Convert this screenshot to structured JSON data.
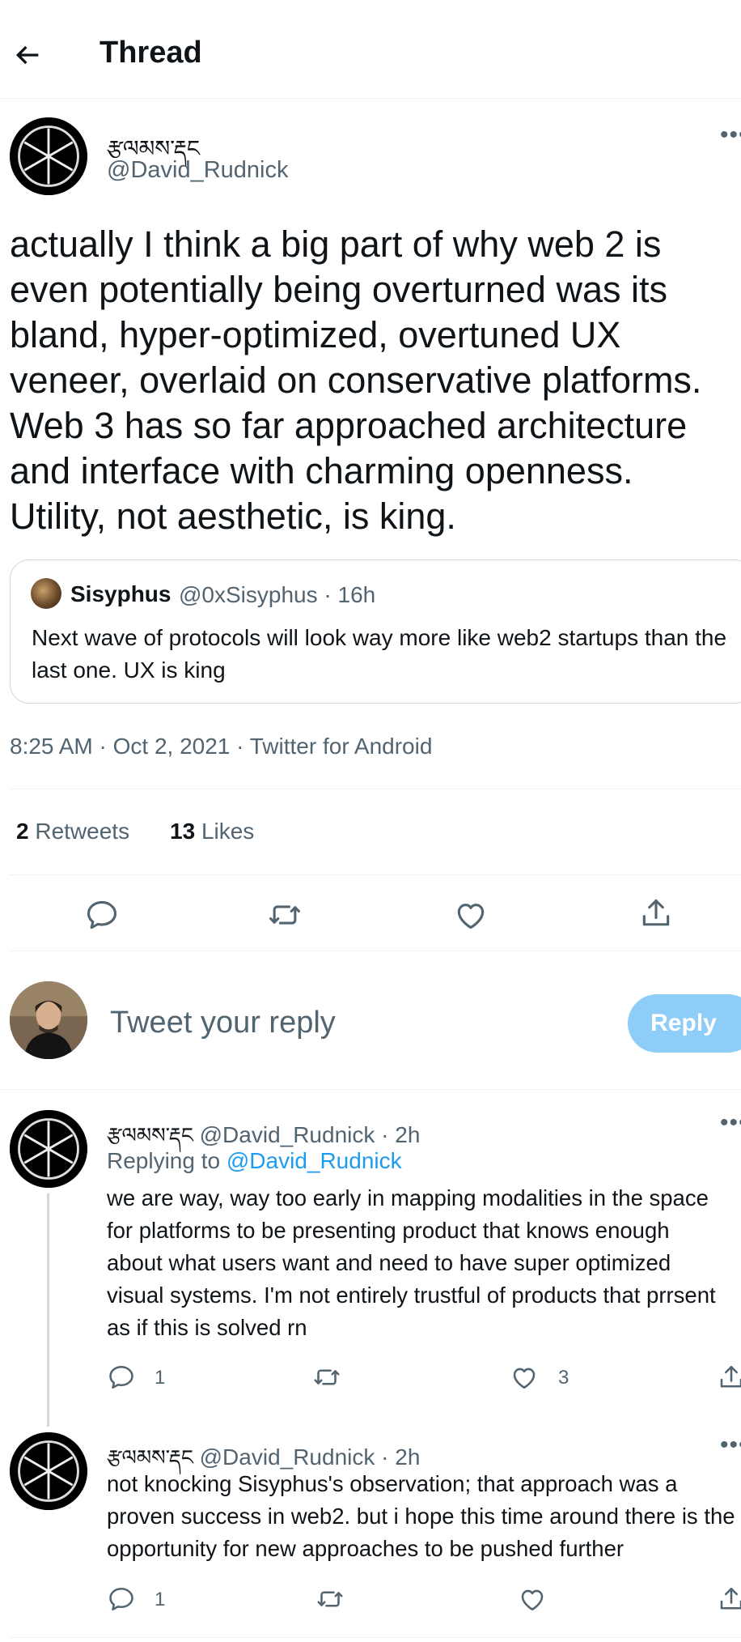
{
  "header": {
    "title": "Thread"
  },
  "main_tweet": {
    "display_name": "རྩལམས་རྡང",
    "handle": "@David_Rudnick",
    "text": "actually I think a big part of why web 2 is even potentially being overturned was its bland, hyper-optimized, overtuned UX veneer, overlaid on conservative platforms. Web 3 has so far approached architecture and interface with charming openness. Utility, not aesthetic, is king.",
    "quote": {
      "name": "Sisyphus",
      "handle_time": "@0xSisyphus · 16h",
      "text": "Next wave of protocols will look way more like web2 startups than the last one. UX is king"
    },
    "meta": "8:25 AM · Oct 2, 2021 · Twitter for Android",
    "retweets_count": "2",
    "retweets_label": "Retweets",
    "likes_count": "13",
    "likes_label": "Likes"
  },
  "compose": {
    "placeholder": "Tweet your reply",
    "button": "Reply"
  },
  "replies": [
    {
      "display_name": "རྩལམས་རྡང",
      "handle_time": "@David_Rudnick · 2h",
      "replying_prefix": "Replying to ",
      "replying_to": "@David_Rudnick",
      "text": "we are way, way too early in mapping modalities in the space for platforms to be presenting product that knows enough about what users want and need to have super optimized visual systems. I'm not entirely trustful of products that prrsent as if this is solved rn",
      "reply_count": "1",
      "like_count": "3"
    },
    {
      "display_name": "རྩལམས་རྡང",
      "handle_time": "@David_Rudnick · 2h",
      "text": "not knocking Sisyphus's observation; that approach was a proven success in web2. but i hope this time around there is the opportunity for new approaches to be pushed further",
      "reply_count": "1"
    }
  ],
  "icons": {
    "back": "arrow-left-icon",
    "more": "more-horizontal-icon",
    "reply": "comment-icon",
    "retweet": "retweet-icon",
    "like": "heart-icon",
    "share": "share-icon"
  },
  "colors": {
    "accent": "#1d9bf0",
    "reply_button_disabled": "#8ecdf8",
    "text": "#0f1419",
    "muted": "#536471"
  }
}
